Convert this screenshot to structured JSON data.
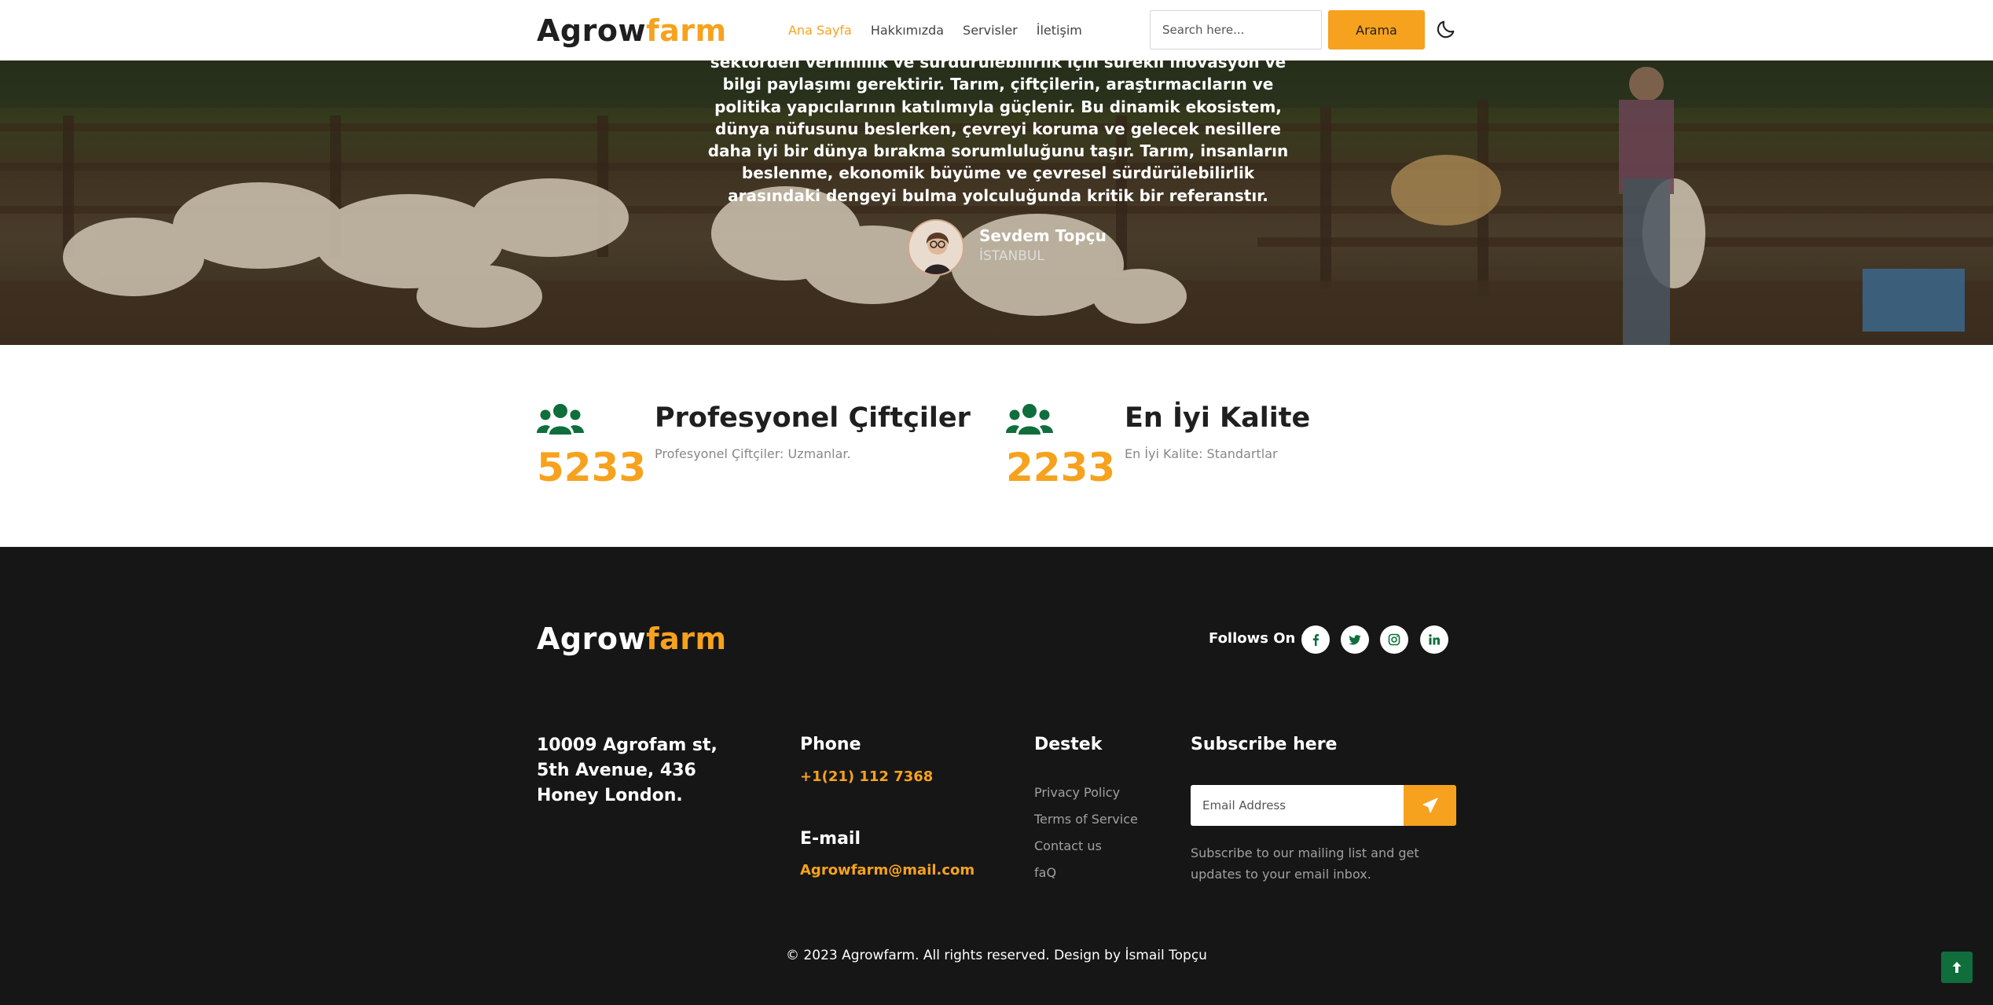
{
  "header": {
    "logo_dark": "Agrow",
    "logo_accent": "farm",
    "nav": [
      "Ana Sayfa",
      "Hakkımızda",
      "Servisler",
      "İletişim"
    ],
    "search_placeholder": "Search here...",
    "search_button": "Arama"
  },
  "hero": {
    "quote": "sektörden verimlilik ve sürdürülebilirlik için sürekli inovasyon ve bilgi paylaşımı gerektirir. Tarım, çiftçilerin, araştırmacıların ve politika yapıcılarının katılımıyla güçlenir. Bu dinamik ekosistem, dünya nüfusunu beslerken, çevreyi koruma ve gelecek nesillere daha iyi bir dünya bırakma sorumluluğunu taşır. Tarım, insanların beslenme, ekonomik büyüme ve çevresel sürdürülebilirlik arasındaki dengeyi bulma yolculuğunda kritik bir referanstır.",
    "author_name": "Sevdem Topçu",
    "author_city": "İSTANBUL"
  },
  "stats": [
    {
      "number": "5233",
      "title": "Profesyonel Çiftçiler",
      "desc": "Profesyonel Çiftçiler: Uzmanlar."
    },
    {
      "number": "2233",
      "title": "En İyi Kalite",
      "desc": "En İyi Kalite: Standartlar"
    }
  ],
  "footer": {
    "logo_dark": "Agrow",
    "logo_accent": "farm",
    "follows": "Follows On :",
    "address": "10009 Agrofam st, 5th Avenue, 436 Honey London.",
    "phone_title": "Phone",
    "phone": "+1(21) 112 7368",
    "email_title": "E-mail",
    "email": "Agrowfarm@mail.com",
    "support_title": "Destek",
    "support_links": [
      "Privacy Policy",
      "Terms of Service",
      "Contact us",
      "faQ"
    ],
    "subscribe_title": "Subscribe here",
    "email_placeholder": "Email Address",
    "subscribe_text": "Subscribe to our mailing list and get updates to your email inbox.",
    "copyright": "© 2023 Agrowfarm. All rights reserved. Design by İsmail Topçu"
  },
  "colors": {
    "accent": "#f6a21e",
    "green": "#0f6e3c",
    "footer_bg": "#161616"
  }
}
